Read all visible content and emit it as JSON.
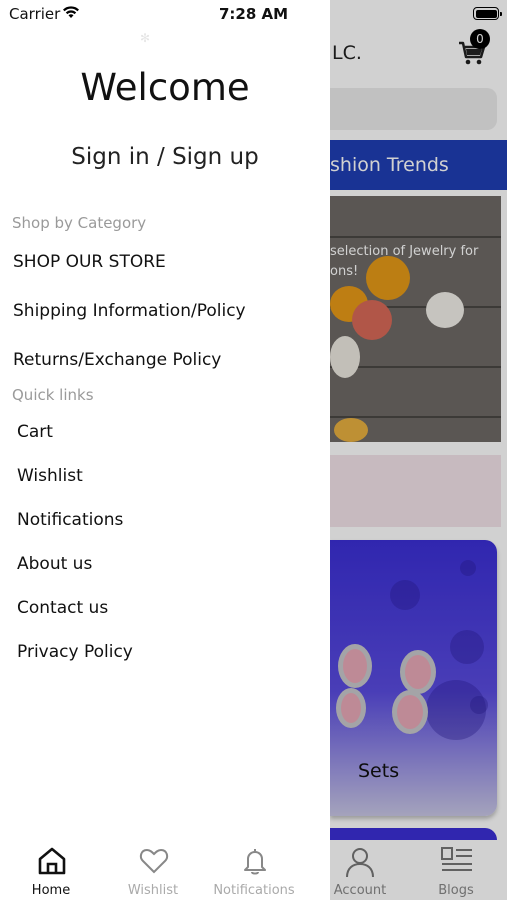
{
  "status_bar": {
    "carrier": "Carrier",
    "time": "7:28 AM"
  },
  "background_app": {
    "store_title": "LC.",
    "cart_count": "0",
    "banner_text": "shion Trends",
    "hero_line1": "selection of Jewelry for",
    "hero_line2": "ons!",
    "category_label": "Sets",
    "tabs": [
      {
        "label": "Account",
        "icon": "account-icon"
      },
      {
        "label": "Blogs",
        "icon": "blogs-icon"
      }
    ]
  },
  "drawer": {
    "welcome": "Welcome",
    "sign_in": "Sign in / Sign up",
    "shop_section": "Shop by Category",
    "shop_items": [
      "SHOP OUR STORE",
      "Shipping Information/Policy",
      "Returns/Exchange Policy"
    ],
    "quick_section": "Quick links",
    "quick_items": [
      "Cart",
      "Wishlist",
      "Notifications",
      "About us",
      "Contact us",
      "Privacy Policy"
    ],
    "tabs": [
      {
        "label": "Home",
        "icon": "home-icon",
        "active": true
      },
      {
        "label": "Wishlist",
        "icon": "heart-icon",
        "active": false
      },
      {
        "label": "Notifications",
        "icon": "bell-icon",
        "active": false
      }
    ]
  },
  "colors": {
    "banner": "#1f3fb5",
    "sets_card": "#3b2fd6",
    "muted_text": "#9a9a9a"
  }
}
